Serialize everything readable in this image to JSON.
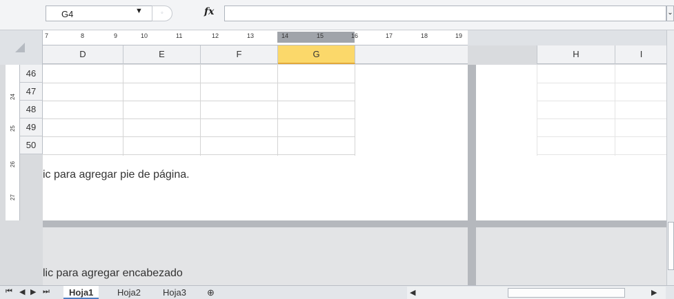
{
  "formula_bar": {
    "name_box": "G4",
    "fx_label": "fx",
    "formula": ""
  },
  "ruler": {
    "ticks": [
      "7",
      "8",
      "9",
      "10",
      "11",
      "12",
      "13",
      "14",
      "15",
      "16",
      "17",
      "18",
      "19"
    ]
  },
  "columns": [
    "D",
    "E",
    "F",
    "G"
  ],
  "columns_right": [
    "H",
    "I"
  ],
  "active_column": "G",
  "rows": [
    "46",
    "47",
    "48",
    "49",
    "50"
  ],
  "vruler": [
    "24",
    "25",
    "26",
    "27"
  ],
  "page": {
    "footer_text": "ic para agregar pie de página.",
    "header_text": "lic para agregar encabezado"
  },
  "sheets": [
    "Hoja1",
    "Hoja2",
    "Hoja3"
  ],
  "active_sheet": "Hoja1"
}
